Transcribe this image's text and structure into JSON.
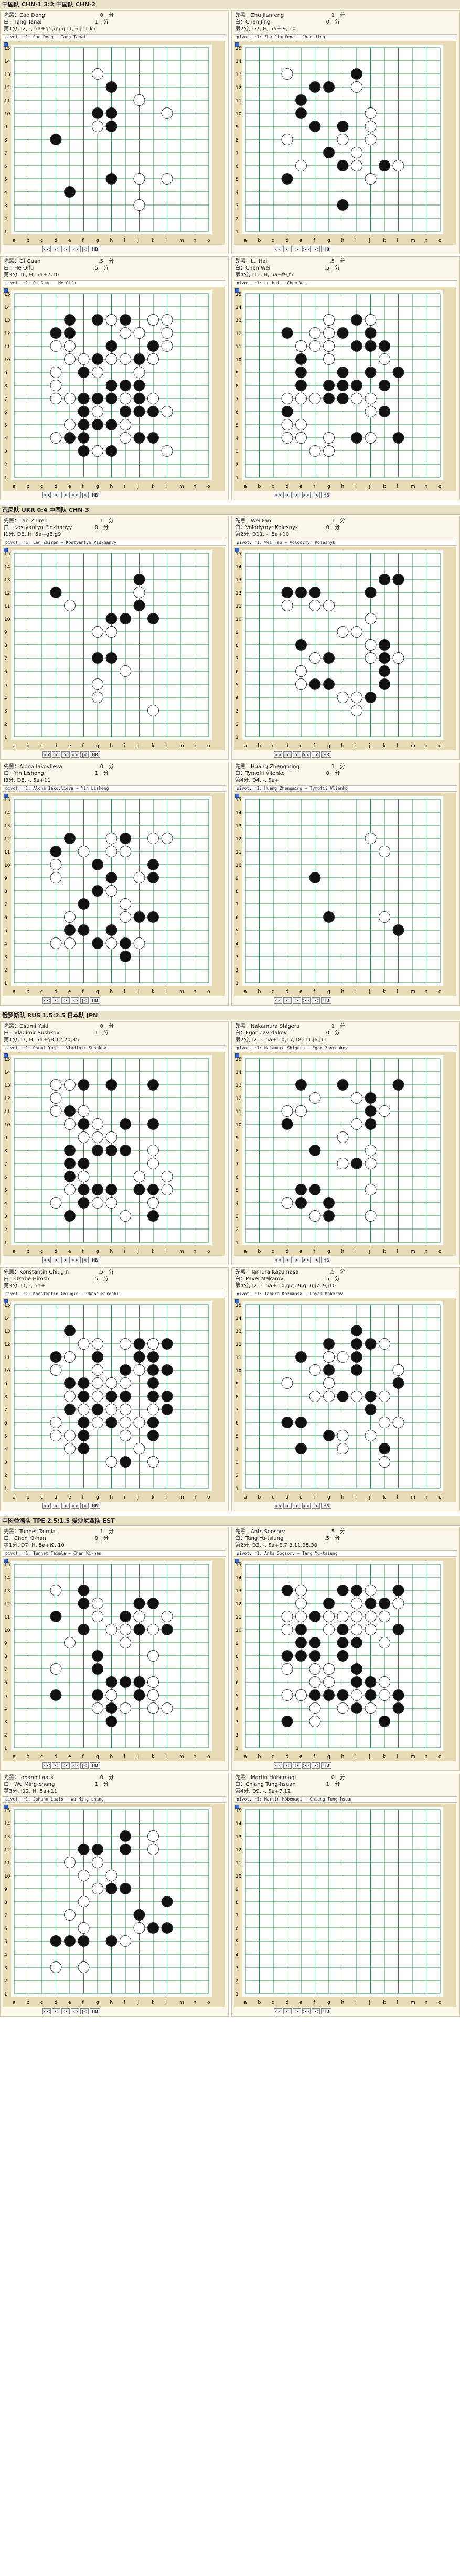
{
  "matches": [
    {
      "header": "中国队 CHN-1 3:2 中国队 CHN-2",
      "games": [
        {
          "black": "Cao Dong",
          "black_score": "0",
          "white": "Tang Tanai",
          "white_score": "1",
          "result": "第1分, I2, -, 5a+g5,g5,g11,j6,j11,k7",
          "title": "pivot. r1: Cao Dong – Tang Tanai",
          "stones": 14
        },
        {
          "black": "Zhu Jianfeng",
          "black_score": "1",
          "white": "Chen Jing",
          "white_score": "0",
          "result": "第2分, D7, H, 5a+i9,i10",
          "title": "pivot. r1: Zhu Jianfeng – Chen Jing",
          "stones": 24
        },
        {
          "black": "Qi Guan",
          "black_score": ".5",
          "white": "He Qifu",
          "white_score": ".5",
          "result": "第3分, I6, H, 5a+7,10",
          "title": "pivot. r1: Qi Guan – He Qifu",
          "stones": 60
        },
        {
          "black": "Lu Hai",
          "black_score": ".5",
          "white": "Chen Wei",
          "white_score": ".5",
          "result": "第4分, I11, H, 5a+f9,f7",
          "title": "pivot. r1: Lu Hai – Chen Wei",
          "stones": 46
        }
      ]
    },
    {
      "header": "荒尼队 UKR 0:4 中国队 CHN-3",
      "games": [
        {
          "black": "Lan Zhiren",
          "black_score": "1",
          "white": "Kostyantyn Pidkhanyy",
          "white_score": "0",
          "result": "I1分, D8, H, 5a+g8,g9",
          "title": "pivot. r1: Lan Zhiren – Kostyantyn Pidkhanyy",
          "stones": 16
        },
        {
          "black": "Wei Fan",
          "black_score": "1",
          "white": "Volodymyr Kolesnyk",
          "white_score": "0",
          "result": "第2分, D11, -, 5a+10",
          "title": "pivot. r1: Wei Fan – Volodymyr Kolesnyk",
          "stones": 30
        },
        {
          "black": "Alona Iakovlieva",
          "black_score": "0",
          "white": "Yin Lisheng",
          "white_score": "1",
          "result": "I3分, D8, -, 5a+11",
          "title": "pivot. r1: Alona Iakovlieva – Yin Lisheng",
          "stones": 34
        },
        {
          "black": "Huang Zhengming",
          "black_score": "1",
          "white": "Tymofii Vlienko",
          "white_score": "0",
          "result": "第4分, D4, -, 5a+",
          "title": "pivot. r1: Huang Zhengming – Tymofii Vlienko",
          "stones": 6
        }
      ]
    },
    {
      "header": "俄罗斯队 RUS 1.5:2.5 日本队 JPN",
      "games": [
        {
          "black": "Osumi Yuki",
          "black_score": "0",
          "white": "Vladimir Sushkov",
          "white_score": "1",
          "result": "第1分, I7, H, 5a+g8,12,20,35",
          "title": "pivot. r1: Osumi Yuki – Vladimir Sushkov",
          "stones": 44
        },
        {
          "black": "Nakamura Shigeru",
          "black_score": "1",
          "white": "Egor Zavrdakov",
          "white_score": "0",
          "result": "第2分, I2, -, 5a+i10,17,18,i11,j6,j11",
          "title": "pivot. r1: Nakamura Shigeru – Egor Zavrdakov",
          "stones": 28
        },
        {
          "black": "Konstantin Chiugin",
          "black_score": ".5",
          "white": "Okabe Hiroshi",
          "white_score": ".5",
          "result": "第3分, I1, -, 5a+",
          "title": "pivot. r1: Konstantin Chiugin – Okabe Hiroshi",
          "stones": 56
        },
        {
          "black": "Tamura Kazumasa",
          "black_score": ".5",
          "white": "Pavel Makarov",
          "white_score": ".5",
          "result": "第4分, I2, -, 5a+i10,g7,g9,g10,j7,j9,j10",
          "title": "pivot. r1: Tamura Kazumasa – Pavel Makarov",
          "stones": 34
        }
      ]
    },
    {
      "header": "中国台湾队 TPE 2.5:1.5 爱沙尼亚队 EST",
      "games": [
        {
          "black": "Tunnet Taimla",
          "black_score": "1",
          "white": "Chen Ki-han",
          "white_score": "0",
          "result": "第1分, D7, H, 5a+i9,i10",
          "title": "pivot. r1: Tunnet Taimla – Chen Ki-han",
          "stones": 38
        },
        {
          "black": "Ants Soosorv",
          "black_score": ".5",
          "white": "Tang Yu-tsiung",
          "white_score": ".5",
          "result": "第2分, D2, -, 5a+6,7,8,11,25,30",
          "title": "pivot. r1: Ants Soosorv – Tang Yu-tsiung",
          "stones": 62
        },
        {
          "black": "Johann Laats",
          "black_score": "0",
          "white": "Wu Ming-chang",
          "white_score": "1",
          "result": "第3分, I12, H, 5a+11",
          "title": "pivot. r1: Johann Laats – Wu Ming-chang",
          "stones": 28
        },
        {
          "black": "Martin Hõbemagi",
          "black_score": "0",
          "white": "Chiang Tung-hsuan",
          "white_score": "1",
          "result": "第4分, D9, -, 5a+7,12",
          "title": "pivot. r1: Martin Hõbemagi – Chiang Tung-hsuan",
          "stones": 0
        }
      ]
    }
  ],
  "labels": {
    "black_prefix": "先黑：",
    "white_prefix": "白：",
    "points": "分",
    "hb": "HB"
  },
  "board": {
    "size": 15,
    "col_letters": [
      "a",
      "b",
      "c",
      "d",
      "e",
      "f",
      "g",
      "h",
      "i",
      "j",
      "k",
      "l",
      "m",
      "n",
      "o"
    ],
    "row_numbers": [
      "15",
      "14",
      "13",
      "12",
      "11",
      "10",
      "9",
      "8",
      "7",
      "6",
      "5",
      "4",
      "3",
      "2",
      "1"
    ],
    "colors": {
      "board": "#ffffff",
      "grid": "#2a8a4a",
      "black": "#111111",
      "white": "#ffffff",
      "frame": "#e8dcb6"
    }
  },
  "controls": [
    "<<",
    "<",
    ">",
    ">>",
    "|<"
  ]
}
